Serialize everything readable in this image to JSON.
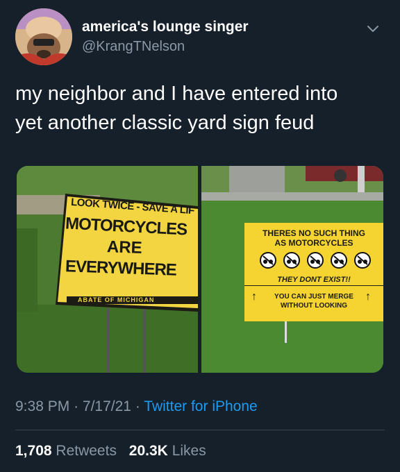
{
  "tweet": {
    "display_name": "america's lounge singer",
    "handle": "@KrangTNelson",
    "text_line1": "my neighbor and I have entered into",
    "text_line2": "yet another classic yard sign feud",
    "time": "9:38 PM",
    "separator": "·",
    "date": "7/17/21",
    "source": "Twitter for iPhone",
    "retweets_count": "1,708",
    "retweets_label": "Retweets",
    "likes_count": "20.3K",
    "likes_label": "Likes"
  },
  "left_sign": {
    "line1": "LOOK TWICE - SAVE A LIF",
    "line2": "MOTORCYCLES",
    "line3": "ARE",
    "line4": "EVERYWHERE",
    "footer": "ABATE OF MICHIGAN",
    "color": "#f2d541"
  },
  "right_sign": {
    "line1": "THERES NO SUCH THING",
    "line2": "AS MOTORCYCLES",
    "line3": "THEY DONT EXIST!!",
    "line4": "YOU CAN JUST MERGE",
    "line5": "WITHOUT LOOKING",
    "color": "#f5d432"
  },
  "colors": {
    "background": "#15202b",
    "secondary_text": "#8b98a5",
    "link": "#1d9bf0",
    "grass": "#4f7d33"
  },
  "icons": {
    "chevron": "chevron-down-icon",
    "avatar": "avatar"
  }
}
